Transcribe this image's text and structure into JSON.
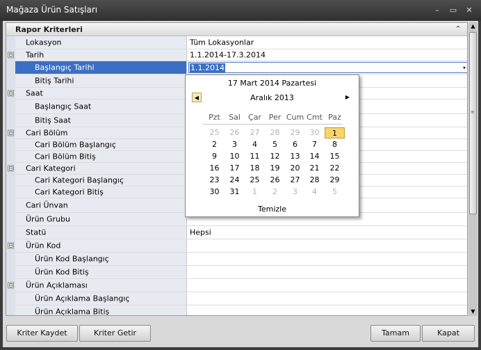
{
  "window": {
    "title": "Mağaza Ürün Satışları",
    "minimize_glyph": "–",
    "maximize_glyph": "▭",
    "close_glyph": "✕"
  },
  "category": {
    "label": "Rapor Kriterleri",
    "collapse_glyph": "⌃"
  },
  "rows": [
    {
      "label": "Lokasyon",
      "value": "Tüm Lokasyonlar"
    },
    {
      "label": "Tarih",
      "value": "1.1.2014-17.3.2014",
      "expander": "⊟"
    },
    {
      "label": "Başlangıç Tarihi",
      "value": "1.1.2014",
      "dropdown": "▾"
    },
    {
      "label": "Bitiş Tarihi",
      "value": ""
    },
    {
      "label": "Saat",
      "value": "",
      "expander": "⊟"
    },
    {
      "label": "Başlangıç Saat",
      "value": ""
    },
    {
      "label": "Bitiş Saat",
      "value": ""
    },
    {
      "label": "Cari Bölüm",
      "value": "",
      "expander": "⊟"
    },
    {
      "label": "Cari Bölüm Başlangıç",
      "value": ""
    },
    {
      "label": "Cari Bölüm Bitiş",
      "value": ""
    },
    {
      "label": "Cari Kategori",
      "value": "",
      "expander": "⊟"
    },
    {
      "label": "Cari Kategori Başlangıç",
      "value": ""
    },
    {
      "label": "Cari Kategori Bitiş",
      "value": ""
    },
    {
      "label": "Cari Ünvan",
      "value": ""
    },
    {
      "label": "Ürün Grubu",
      "value": ""
    },
    {
      "label": "Statü",
      "value": "Hepsi"
    },
    {
      "label": "Ürün Kod",
      "value": "",
      "expander": "⊟"
    },
    {
      "label": "Ürün Kod Başlangıç",
      "value": ""
    },
    {
      "label": "Ürün Kod Bitiş",
      "value": ""
    },
    {
      "label": "Ürün Açıklaması",
      "value": "",
      "expander": "⊟"
    },
    {
      "label": "Ürün Açıklama Başlangıç",
      "value": ""
    },
    {
      "label": "Ürün Açıklama Bitiş",
      "value": ""
    }
  ],
  "calendar": {
    "today_label": "17 Mart 2014 Pazartesi",
    "month_label": "Aralık 2013",
    "prev_glyph": "◀",
    "next_glyph": "▶",
    "weekdays": [
      "Pzt",
      "Sal",
      "Çar",
      "Per",
      "Cum",
      "Cmt",
      "Paz"
    ],
    "weeks": [
      [
        "25",
        "26",
        "27",
        "28",
        "29",
        "30",
        "1"
      ],
      [
        "2",
        "3",
        "4",
        "5",
        "6",
        "7",
        "8"
      ],
      [
        "9",
        "10",
        "11",
        "12",
        "13",
        "14",
        "15"
      ],
      [
        "16",
        "17",
        "18",
        "19",
        "20",
        "21",
        "22"
      ],
      [
        "23",
        "24",
        "25",
        "26",
        "27",
        "28",
        "29"
      ],
      [
        "30",
        "31",
        "1",
        "2",
        "3",
        "4",
        "5"
      ]
    ],
    "selected_day": "1",
    "clear_label": "Temizle",
    "colors": {
      "selected_fill": "#f5d66a",
      "other_month": "#b3b3b3"
    }
  },
  "scrollbar": {
    "up_glyph": "▲",
    "down_glyph": "▼",
    "grip_glyph": "≡"
  },
  "buttons": {
    "save": "Kriter Kaydet",
    "load": "Kriter Getir",
    "ok": "Tamam",
    "close": "Kapat"
  },
  "colors": {
    "selection": "#3a6fc4",
    "name_column": "#e8eaf1",
    "titlebar": "#3c3c3c"
  }
}
